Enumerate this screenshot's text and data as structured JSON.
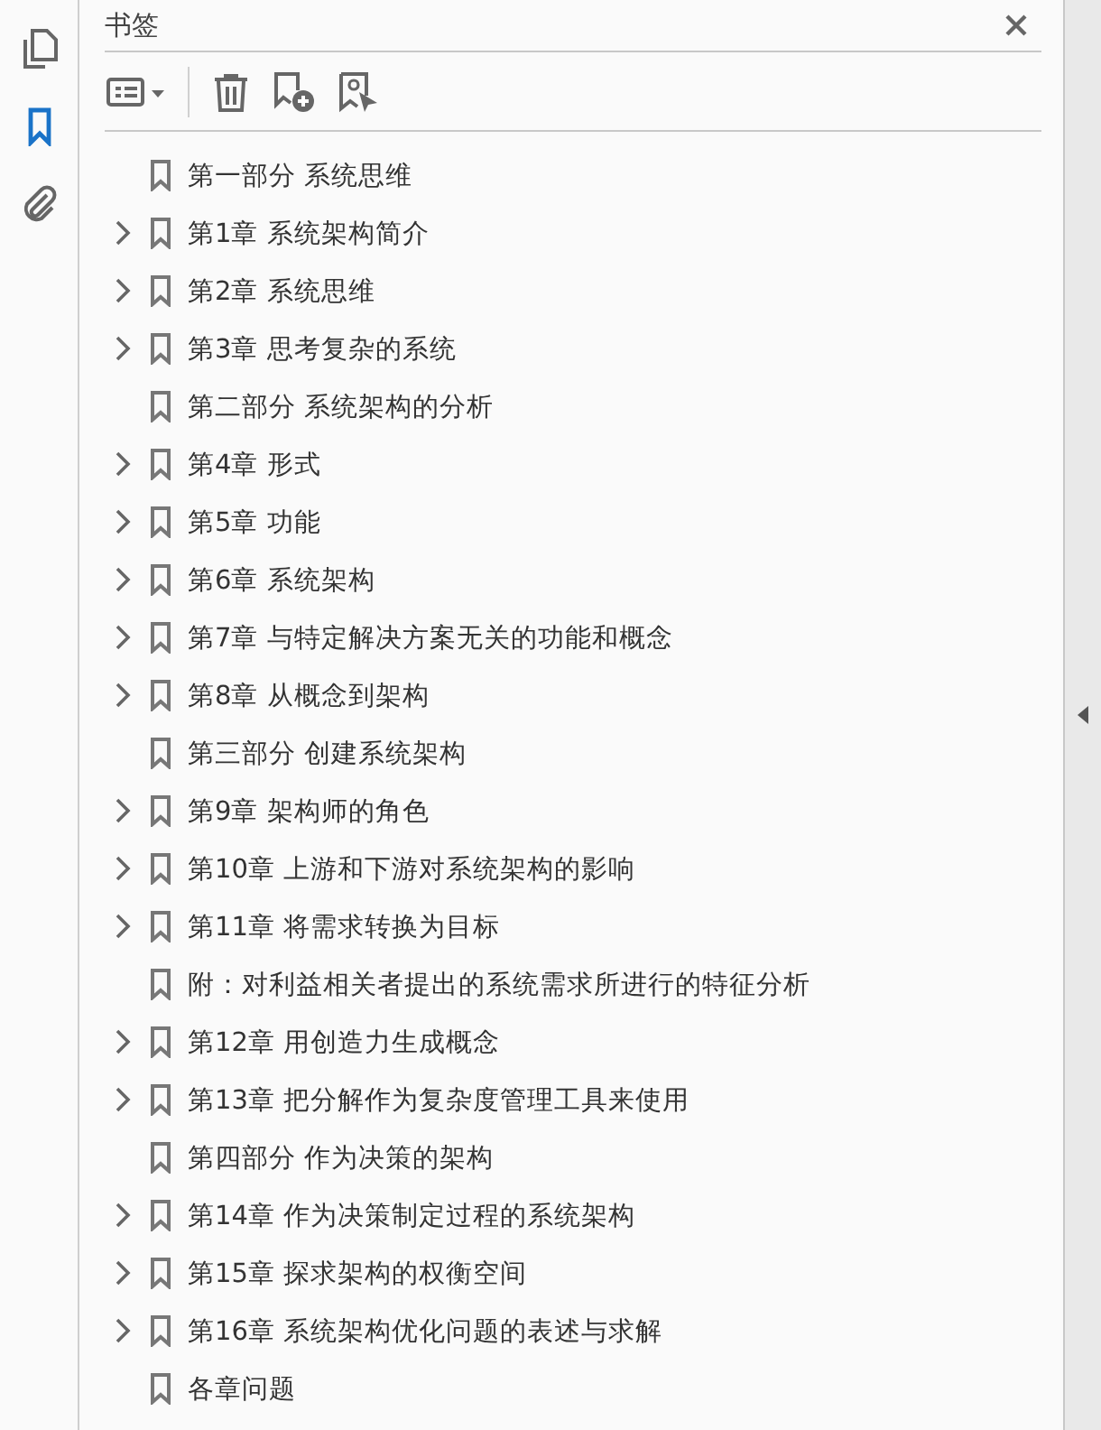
{
  "panel": {
    "title": "书签"
  },
  "bookmarks": [
    {
      "label": "第一部分 系统思维",
      "expandable": false
    },
    {
      "label": "第1章 系统架构简介",
      "expandable": true
    },
    {
      "label": "第2章 系统思维",
      "expandable": true
    },
    {
      "label": "第3章 思考复杂的系统",
      "expandable": true
    },
    {
      "label": "第二部分 系统架构的分析",
      "expandable": false
    },
    {
      "label": "第4章 形式",
      "expandable": true
    },
    {
      "label": "第5章 功能",
      "expandable": true
    },
    {
      "label": "第6章 系统架构",
      "expandable": true
    },
    {
      "label": "第7章 与特定解决方案无关的功能和概念",
      "expandable": true
    },
    {
      "label": "第8章 从概念到架构",
      "expandable": true
    },
    {
      "label": "第三部分 创建系统架构",
      "expandable": false
    },
    {
      "label": "第9章 架构师的角色",
      "expandable": true
    },
    {
      "label": "第10章 上游和下游对系统架构的影响",
      "expandable": true
    },
    {
      "label": "第11章 将需求转换为目标",
      "expandable": true
    },
    {
      "label": "附：对利益相关者提出的系统需求所进行的特征分析",
      "expandable": false
    },
    {
      "label": "第12章 用创造力生成概念",
      "expandable": true
    },
    {
      "label": "第13章 把分解作为复杂度管理工具来使用",
      "expandable": true
    },
    {
      "label": "第四部分 作为决策的架构",
      "expandable": false
    },
    {
      "label": "第14章 作为决策制定过程的系统架构",
      "expandable": true
    },
    {
      "label": "第15章 探求架构的权衡空间",
      "expandable": true
    },
    {
      "label": "第16章 系统架构优化问题的表述与求解",
      "expandable": true
    },
    {
      "label": "各章问题",
      "expandable": false
    }
  ]
}
